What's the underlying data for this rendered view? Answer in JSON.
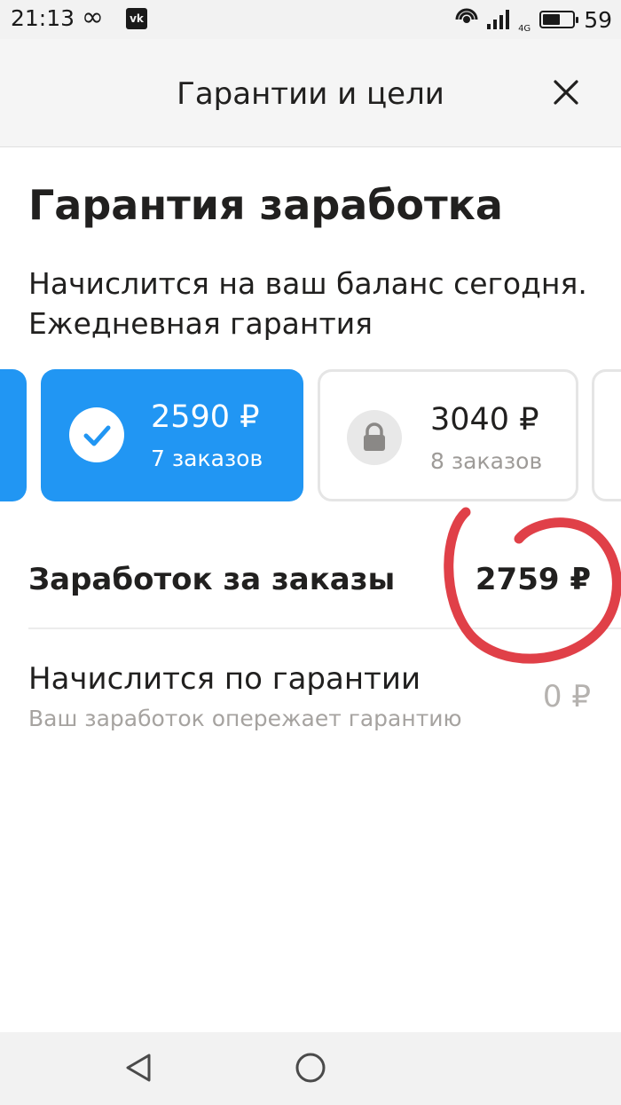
{
  "status_bar": {
    "time": "21:13",
    "infinity_symbol": "∞",
    "vk_icon": "vk",
    "network": "4G",
    "battery": "59",
    "battery_level": 0.59
  },
  "header": {
    "title": "Гарантии и цели"
  },
  "guarantee": {
    "title": "Гарантия заработка",
    "subtitle": "Начислится на ваш баланс сегодня. Ежедневная гарантия",
    "tiers": [
      {
        "amount": "2590 ₽",
        "orders": "7 заказов",
        "state": "achieved"
      },
      {
        "amount": "3040 ₽",
        "orders": "8 заказов",
        "state": "locked"
      }
    ]
  },
  "earnings": {
    "label": "Заработок за заказы",
    "value": "2759 ₽"
  },
  "guarantee_payout": {
    "label": "Начислится по гарантии",
    "note": "Ваш заработок опережает гарантию",
    "value": "0 ₽"
  },
  "colors": {
    "accent": "#2196f3",
    "annotation": "#e04048"
  }
}
